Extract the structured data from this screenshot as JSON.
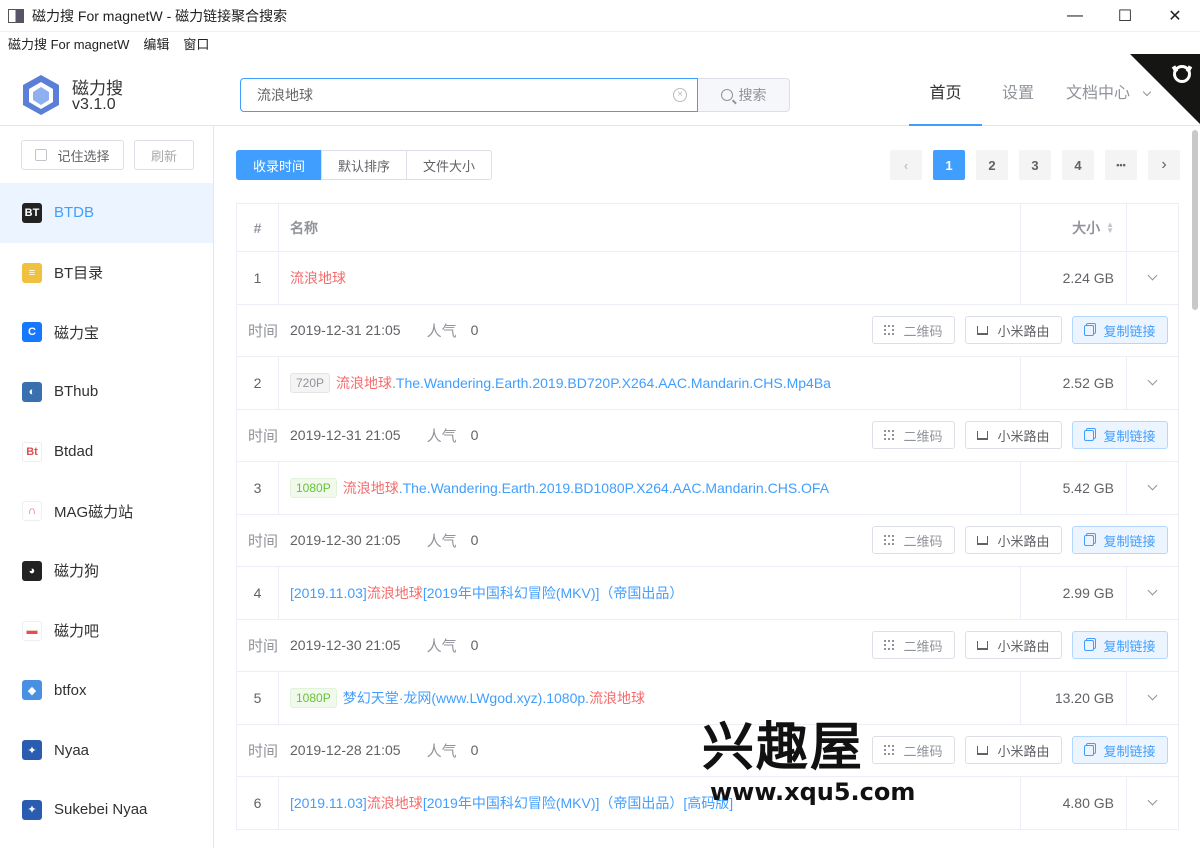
{
  "window": {
    "title": "磁力搜 For magnetW - 磁力链接聚合搜索",
    "controls": [
      "—",
      "☐",
      "✕"
    ]
  },
  "menu": [
    "磁力搜 For magnetW",
    "编辑",
    "窗口"
  ],
  "brand": {
    "name": "磁力搜",
    "version": "v3.1.0"
  },
  "search": {
    "value": "流浪地球",
    "placeholder": "",
    "button_label": "搜索"
  },
  "nav": {
    "home": "首页",
    "settings": "设置",
    "docs": "文档中心"
  },
  "sidebar": {
    "remember_label": "记住选择",
    "refresh_label": "刷新",
    "sites": [
      {
        "name": "BTDB",
        "icon": "btdb-icon",
        "color": "#222222",
        "glyph": "BT",
        "active": true
      },
      {
        "name": "BT目录",
        "icon": "book-icon",
        "color": "#f0c040",
        "glyph": "≡",
        "active": false
      },
      {
        "name": "磁力宝",
        "icon": "c-icon",
        "color": "#1677ff",
        "glyph": "C",
        "active": false
      },
      {
        "name": "BThub",
        "icon": "globe-icon",
        "color": "#3a6fb0",
        "glyph": "◐",
        "active": false
      },
      {
        "name": "Btdad",
        "icon": "bt-icon",
        "color": "#ffffff",
        "glyph": "Bt",
        "active": false
      },
      {
        "name": "MAG磁力站",
        "icon": "magnet-icon",
        "color": "#ffffff",
        "glyph": "∩",
        "active": false
      },
      {
        "name": "磁力狗",
        "icon": "dog-icon",
        "color": "#222222",
        "glyph": "◕",
        "active": false
      },
      {
        "name": "磁力吧",
        "icon": "bar-icon",
        "color": "#ffffff",
        "glyph": "▬",
        "active": false
      },
      {
        "name": "btfox",
        "icon": "fox-icon",
        "color": "#4a90e2",
        "glyph": "◆",
        "active": false
      },
      {
        "name": "Nyaa",
        "icon": "nyaa-icon",
        "color": "#2a5db0",
        "glyph": "✦",
        "active": false
      },
      {
        "name": "Sukebei Nyaa",
        "icon": "sukebei-icon",
        "color": "#2a5db0",
        "glyph": "✦",
        "active": false
      }
    ]
  },
  "sort": {
    "options": [
      "收录时间",
      "默认排序",
      "文件大小"
    ],
    "active_index": 0
  },
  "pagination": {
    "prev": "‹",
    "pages": [
      "1",
      "2",
      "3",
      "4"
    ],
    "ellipsis": "•••",
    "next": "›",
    "current": "1"
  },
  "table": {
    "headers": {
      "index": "#",
      "name": "名称",
      "size": "大小"
    },
    "meta_labels": {
      "time": "时间",
      "hot": "人气"
    },
    "actions": {
      "qrcode": "二维码",
      "xiaomi": "小米路由",
      "copy": "复制链接"
    },
    "rows": [
      {
        "index": "1",
        "tag": "",
        "tag_color": "",
        "name_parts": [
          {
            "t": "流浪地球",
            "h": true
          }
        ],
        "size": "2.24 GB",
        "time": "2019-12-31 21:05",
        "hot": "0"
      },
      {
        "index": "2",
        "tag": "720P",
        "tag_color": "gray",
        "name_parts": [
          {
            "t": "流浪地球",
            "h": true
          },
          {
            "t": ".The.Wandering.Earth.2019.BD720P.X264.AAC.Mandarin.CHS.Mp4Ba",
            "h": false
          }
        ],
        "size": "2.52 GB",
        "time": "2019-12-31 21:05",
        "hot": "0"
      },
      {
        "index": "3",
        "tag": "1080P",
        "tag_color": "green",
        "name_parts": [
          {
            "t": "流浪地球",
            "h": true
          },
          {
            "t": ".The.Wandering.Earth.2019.BD1080P.X264.AAC.Mandarin.CHS.OFA",
            "h": false
          }
        ],
        "size": "5.42 GB",
        "time": "2019-12-30 21:05",
        "hot": "0"
      },
      {
        "index": "4",
        "tag": "",
        "tag_color": "",
        "name_parts": [
          {
            "t": "[2019.11.03]",
            "h": false
          },
          {
            "t": "流浪地球",
            "h": true
          },
          {
            "t": "[2019年中国科幻冒险(MKV)]（帝国出品）",
            "h": false
          }
        ],
        "size": "2.99 GB",
        "time": "2019-12-30 21:05",
        "hot": "0"
      },
      {
        "index": "5",
        "tag": "1080P",
        "tag_color": "green",
        "name_parts": [
          {
            "t": "梦幻天堂·龙网(www.LWgod.xyz).1080p.",
            "h": false
          },
          {
            "t": "流浪地球",
            "h": true
          }
        ],
        "size": "13.20 GB",
        "time": "2019-12-28 21:05",
        "hot": "0"
      },
      {
        "index": "6",
        "tag": "",
        "tag_color": "",
        "name_parts": [
          {
            "t": "[2019.11.03]",
            "h": false
          },
          {
            "t": "流浪地球",
            "h": true
          },
          {
            "t": "[2019年中国科幻冒险(MKV)]（帝国出品）[高码版]",
            "h": false
          }
        ],
        "size": "4.80 GB",
        "time": "",
        "hot": ""
      }
    ]
  },
  "watermark": {
    "text": "兴趣屋",
    "url": "www.xqu5.com"
  },
  "colors": {
    "accent": "#409eff",
    "highlight": "#f56c6c"
  }
}
